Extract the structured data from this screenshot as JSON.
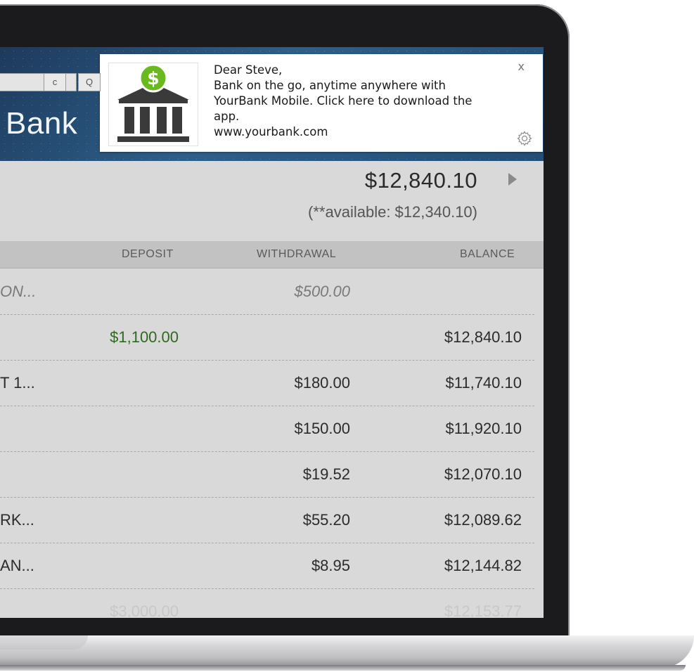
{
  "browser": {
    "refresh_glyph": "c",
    "search_glyph": "Q"
  },
  "app": {
    "bank_name": "Bank"
  },
  "account": {
    "balance": "$12,840.10",
    "available": "(**available: $12,340.10)"
  },
  "table": {
    "headers": {
      "deposit": "DEPOSIT",
      "withdrawal": "WITHDRAWAL",
      "balance": "BALANCE"
    },
    "rows": [
      {
        "desc": "ON...",
        "deposit": "",
        "withdrawal": "$500.00",
        "balance": ""
      },
      {
        "desc": "",
        "deposit": "$1,100.00",
        "withdrawal": "",
        "balance": "$12,840.10"
      },
      {
        "desc": "T 1...",
        "deposit": "",
        "withdrawal": "$180.00",
        "balance": "$11,740.10"
      },
      {
        "desc": "",
        "deposit": "",
        "withdrawal": "$150.00",
        "balance": "$11,920.10"
      },
      {
        "desc": "",
        "deposit": "",
        "withdrawal": "$19.52",
        "balance": "$12,070.10"
      },
      {
        "desc": "RK...",
        "deposit": "",
        "withdrawal": "$55.20",
        "balance": "$12,089.62"
      },
      {
        "desc": "AN...",
        "deposit": "",
        "withdrawal": "$8.95",
        "balance": "$12,144.82"
      },
      {
        "desc": "",
        "deposit": "$3,000.00",
        "withdrawal": "",
        "balance": "$12,153.77"
      }
    ]
  },
  "notification": {
    "greeting": "Dear Steve,",
    "body": "Bank on the go, anytime anywhere with YourBank Mobile. Click here to download the app.",
    "url": "www.yourbank.com",
    "close_glyph": "x",
    "icon": "bank-dollar-icon",
    "settings_icon": "gear-icon"
  },
  "colors": {
    "deposit_green": "#2e6a1e",
    "header_blue": "#2e5f8a",
    "icon_green": "#6aba1f"
  }
}
